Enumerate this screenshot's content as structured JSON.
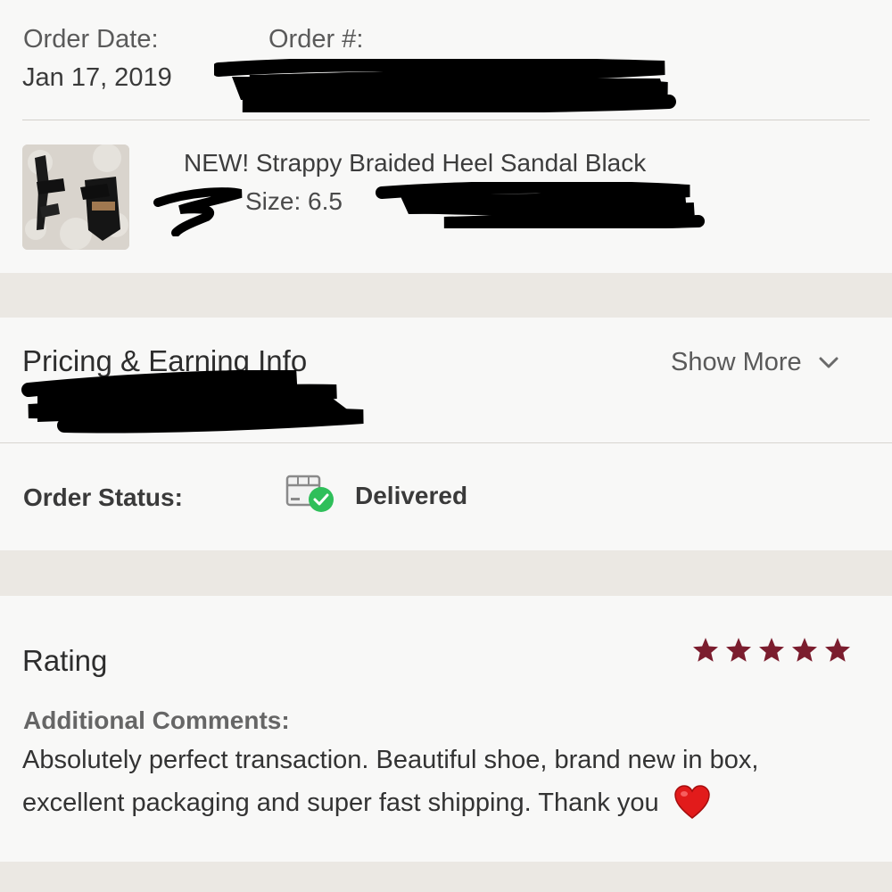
{
  "order": {
    "date_label": "Order Date:",
    "date_value": "Jan 17, 2019",
    "number_label": "Order #:"
  },
  "item": {
    "title": "NEW! Strappy Braided Heel Sandal Black",
    "size_text": "Size: 6.5",
    "thumbnail_icon": "sandal-photo"
  },
  "pricing": {
    "heading": "Pricing & Earning Info",
    "show_more": "Show More",
    "chevron_icon": "chevron-down-icon"
  },
  "status": {
    "label": "Order Status:",
    "value": "Delivered",
    "icon": "delivered-box-icon"
  },
  "rating": {
    "heading": "Rating",
    "stars": 5,
    "star_color": "#7b1d2e",
    "comments_label": "Additional Comments:",
    "comment_line1": "Absolutely perfect transaction. Beautiful shoe, brand new in box,",
    "comment_line2": "excellent packaging and super fast shipping. Thank you"
  },
  "colors": {
    "background": "#ebe8e3",
    "card": "#f8f8f7",
    "success": "#2fbf5a",
    "heart": "#e21b1b"
  }
}
